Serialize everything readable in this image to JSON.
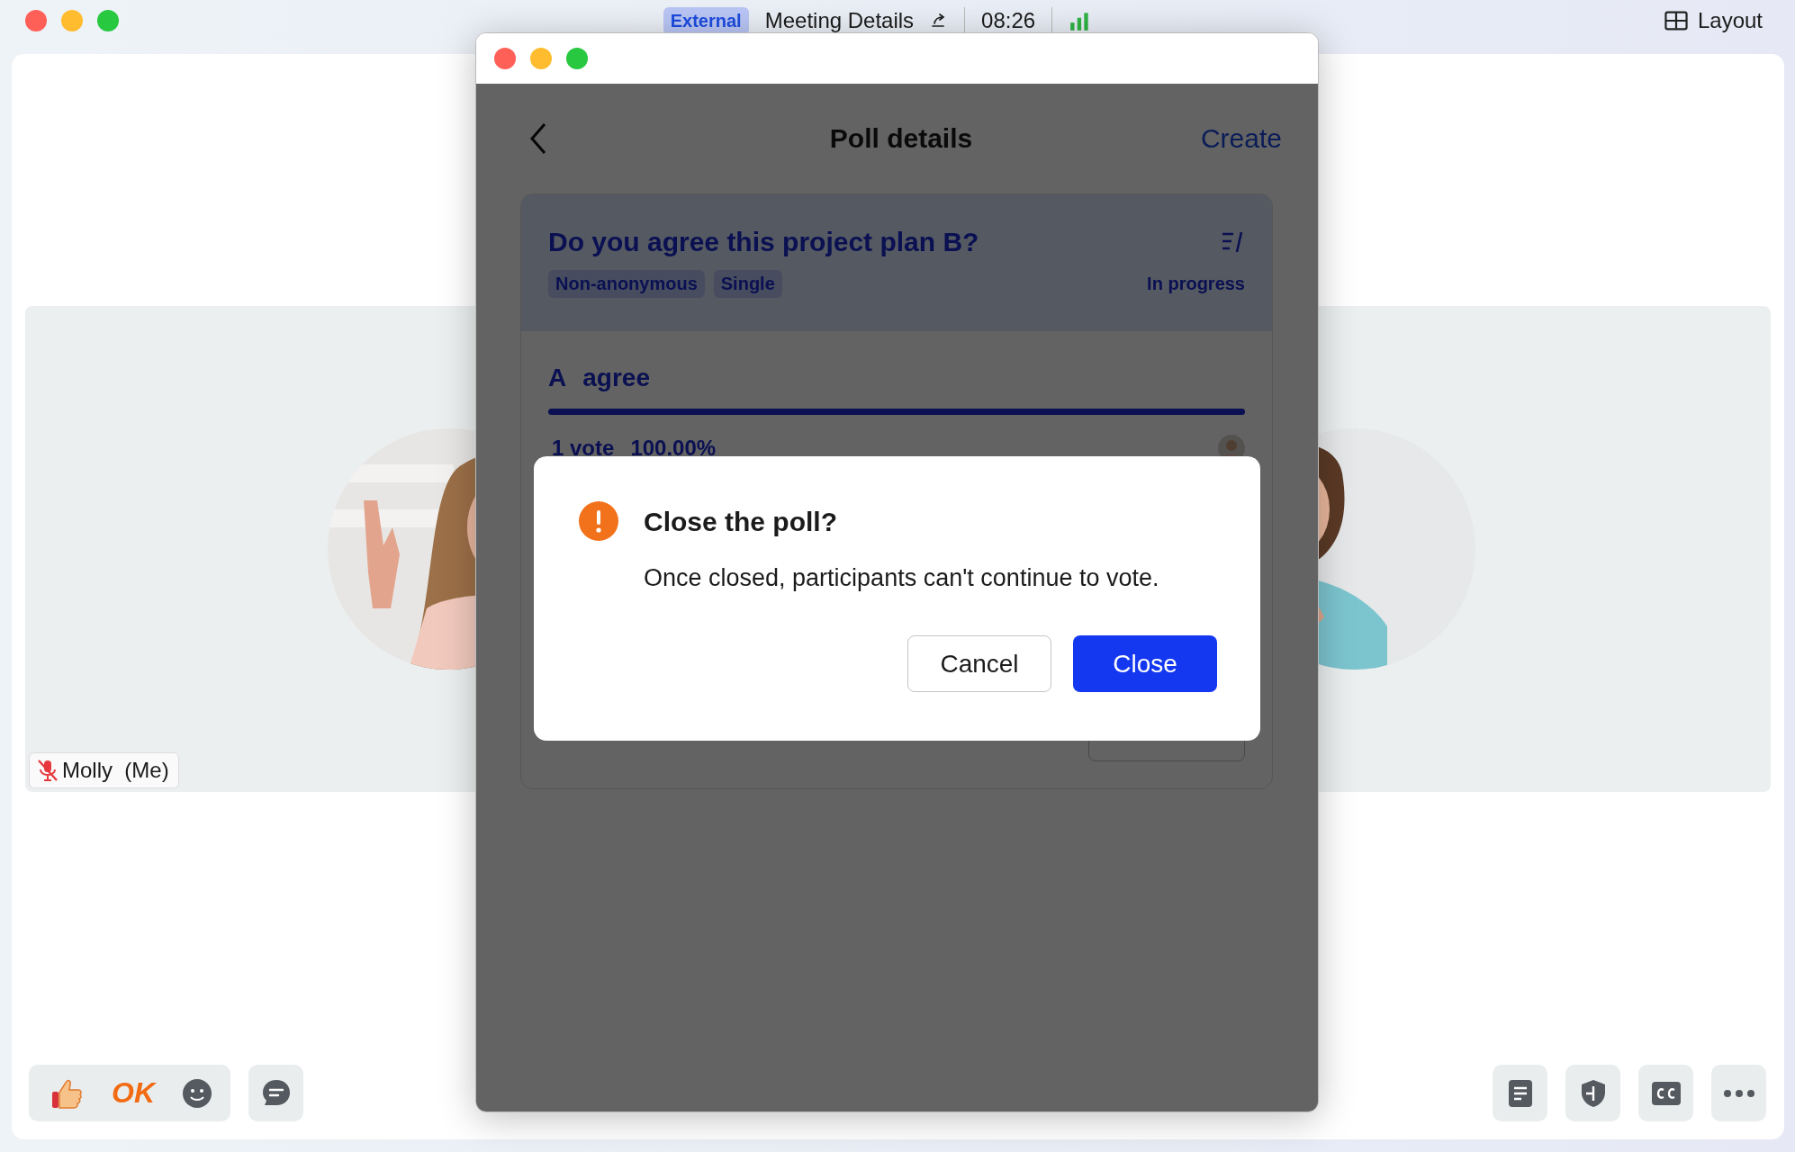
{
  "titlebar": {
    "badge": "External",
    "title": "Meeting Details",
    "time": "08:26",
    "layout_label": "Layout"
  },
  "participants": [
    {
      "name": "Molly  (Me)",
      "muted": true
    }
  ],
  "reaction_bar": {
    "ok_label": "OK"
  },
  "poll_window": {
    "title": "Poll details",
    "create": "Create",
    "question": "Do you agree this project plan B?",
    "tags": [
      "Non-anonymous",
      "Single"
    ],
    "status": "In progress",
    "options": [
      {
        "letter": "A",
        "text": "agree",
        "level": 1,
        "votes": "1 vote",
        "percent": "100.00%"
      }
    ]
  },
  "dialog": {
    "title": "Close the poll?",
    "message": "Once closed, participants can't continue to vote.",
    "buttons": [
      {
        "label": "Cancel",
        "kind": "secondary"
      },
      {
        "label": "Close",
        "kind": "primary"
      }
    ]
  }
}
